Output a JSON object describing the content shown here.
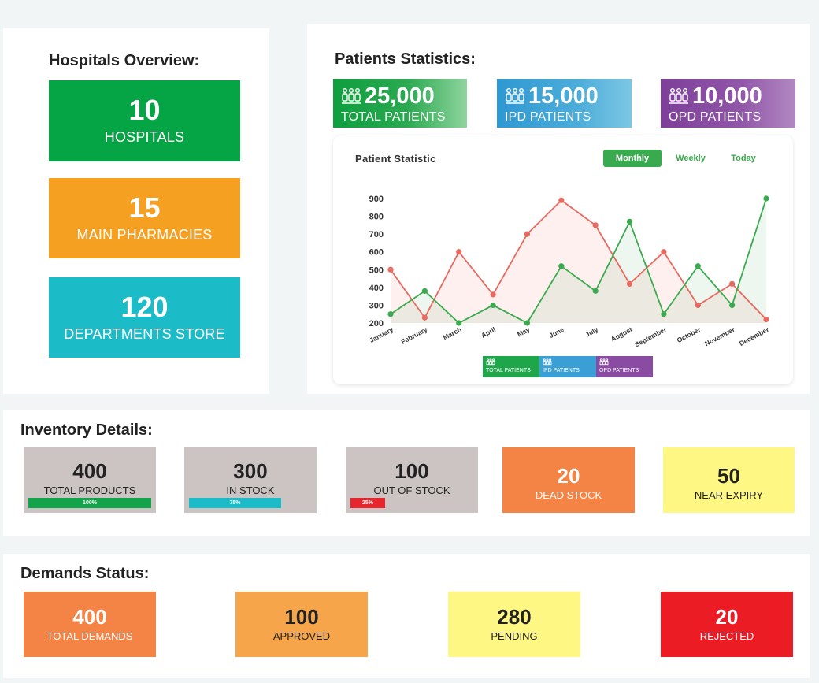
{
  "hospitals": {
    "title": "Hospitals Overview:",
    "tiles": [
      {
        "value": "10",
        "label": "HOSPITALS",
        "color": "#05a445"
      },
      {
        "value": "15",
        "label": "MAIN PHARMACIES",
        "color": "#f6a022"
      },
      {
        "value": "120",
        "label": "DEPARTMENTS STORE",
        "color": "#1bbbc8"
      }
    ]
  },
  "patients": {
    "title": "Patients Statistics:",
    "stats": [
      {
        "value": "25,000",
        "label": "TOTAL PATIENTS",
        "icon": "patients-group-icon",
        "color": "#1fa64a"
      },
      {
        "value": "15,000",
        "label": "IPD PATIENTS",
        "icon": "patients-group-icon",
        "color": "#3a9fd4"
      },
      {
        "value": "10,000",
        "label": "OPD PATIENTS",
        "icon": "patients-group-icon",
        "color": "#8a4ba3"
      }
    ],
    "chart_title": "Patient Statistic",
    "tabs": [
      "Monthly",
      "Weekly",
      "Today"
    ],
    "active_tab": "Monthly",
    "legend": [
      "TOTAL PATIENTS",
      "IPD PATIENTS",
      "OPD PATIENTS"
    ]
  },
  "chart_data": {
    "type": "line",
    "title": "Patient Statistic",
    "categories": [
      "January",
      "February",
      "March",
      "April",
      "May",
      "June",
      "July",
      "August",
      "September",
      "October",
      "November",
      "December"
    ],
    "series": [
      {
        "color": "#e8695f",
        "values": [
          500,
          230,
          600,
          360,
          700,
          890,
          750,
          420,
          600,
          300,
          420,
          220
        ]
      },
      {
        "color": "#3aaa4e",
        "values": [
          250,
          380,
          200,
          300,
          200,
          520,
          380,
          770,
          250,
          520,
          300,
          900
        ]
      }
    ],
    "yticks": [
      200,
      300,
      400,
      500,
      600,
      700,
      800,
      900
    ],
    "ylim": [
      200,
      900
    ],
    "grid": false,
    "legend_position": "bottom",
    "legend": [
      "TOTAL PATIENTS",
      "IPD PATIENTS",
      "OPD PATIENTS"
    ],
    "legend_colors": [
      "#1fa64a",
      "#3a9fd4",
      "#8a4ba3"
    ]
  },
  "inventory": {
    "title": "Inventory Details:",
    "items": [
      {
        "value": "400",
        "label": "TOTAL PRODUCTS",
        "progress": "100%",
        "progress_fraction": 1.0,
        "bar_color": "#14a24a",
        "bg": "#cbc4c2"
      },
      {
        "value": "300",
        "label": "IN STOCK",
        "progress": "75%",
        "progress_fraction": 0.75,
        "bar_color": "#1bbbc8",
        "bg": "#cbc4c2"
      },
      {
        "value": "100",
        "label": "OUT OF STOCK",
        "progress": "25%",
        "progress_fraction": 0.25,
        "bar_color": "#e5262e",
        "bg": "#cbc4c2"
      },
      {
        "value": "20",
        "label": "DEAD STOCK",
        "bg": "#f48446"
      },
      {
        "value": "50",
        "label": "NEAR EXPIRY",
        "bg": "#fef784"
      }
    ]
  },
  "demands": {
    "title": "Demands Status:",
    "items": [
      {
        "value": "400",
        "label": "TOTAL DEMANDS",
        "bg": "#f48446"
      },
      {
        "value": "100",
        "label": "APPROVED",
        "bg": "#f6a54a"
      },
      {
        "value": "280",
        "label": "PENDING",
        "bg": "#fef784"
      },
      {
        "value": "20",
        "label": "REJECTED",
        "bg": "#ec1c24"
      }
    ]
  }
}
